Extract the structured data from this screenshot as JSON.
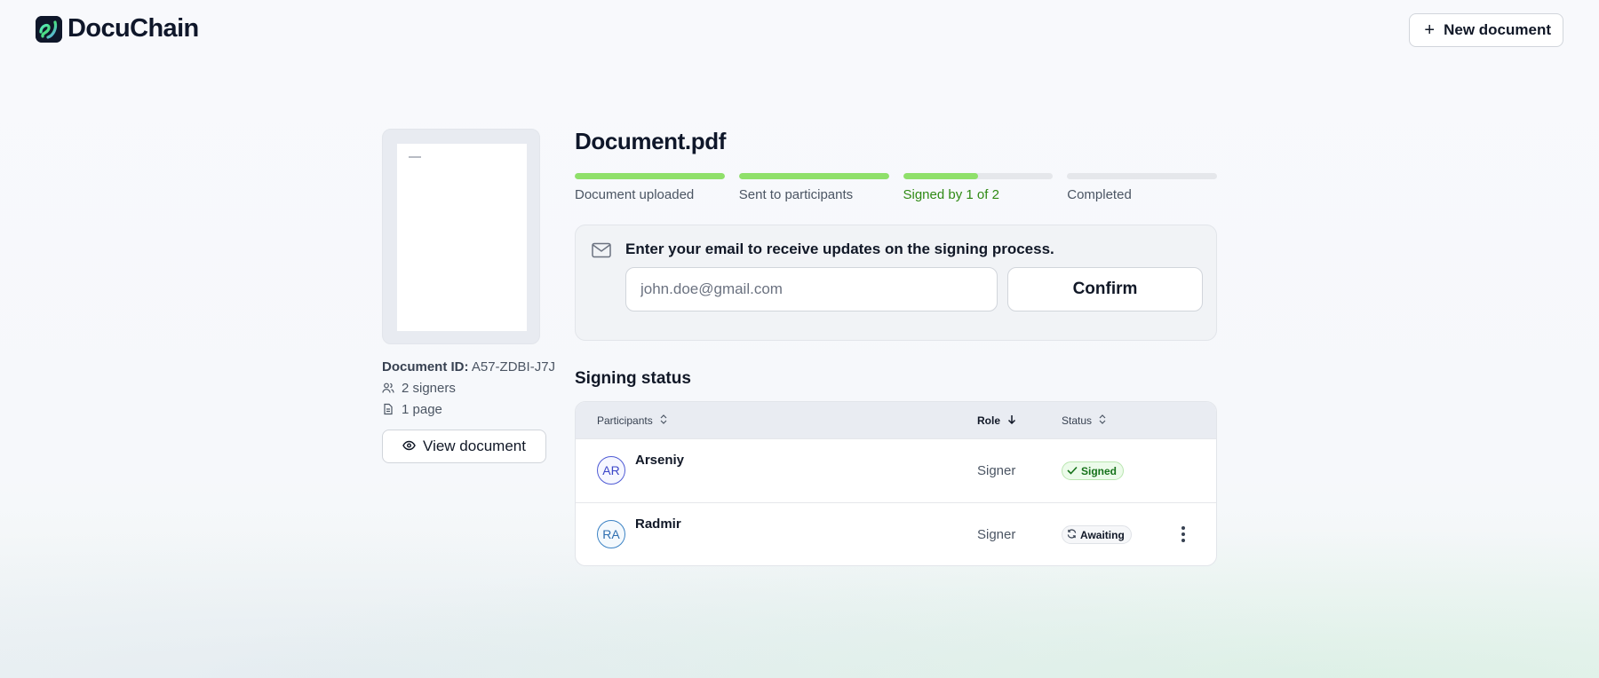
{
  "header": {
    "logo_text": "DocuChain",
    "new_document_label": "New document"
  },
  "sidebar": {
    "document_id_label": "Document ID:",
    "document_id_value": "A57-ZDBI-J7J",
    "signers": "2 signers",
    "pages": "1 page",
    "view_document_label": "View document"
  },
  "main": {
    "title": "Document.pdf",
    "steps": [
      {
        "label": "Document uploaded",
        "progress": 1.0
      },
      {
        "label": "Sent to participants",
        "progress": 1.0
      },
      {
        "label": "Signed by  1 of 2",
        "progress": 0.5
      },
      {
        "label": "Completed",
        "progress": 0.0
      }
    ],
    "email": {
      "prompt": "Enter your email to receive updates on the signing process.",
      "placeholder": "john.doe@gmail.com",
      "value": "",
      "confirm_label": "Confirm"
    },
    "signing_status": {
      "title": "Signing status",
      "columns": [
        "Participants",
        "Role",
        "Status"
      ],
      "rows": [
        {
          "initials": "AR",
          "name": "Arseniy",
          "role": "Signer",
          "status": "Signed"
        },
        {
          "initials": "RA",
          "name": "Radmir",
          "role": "Signer",
          "status": "Awaiting"
        }
      ]
    }
  },
  "colors": {
    "progress_fill": "#8fe06a",
    "progress_track": "#e5e7eb",
    "active_step_text": "#2f8a14",
    "signed_badge_bg": "#ecfbea",
    "signed_badge_text": "#16721a"
  },
  "icons": {
    "logo": "docuchain-logo-icon",
    "new_document": "plus-icon",
    "signers": "users-icon",
    "pages": "file-icon",
    "view": "eye-icon",
    "email": "mail-icon",
    "sort": "sort-icon",
    "sort_down": "arrow-down-icon",
    "signed": "check-icon",
    "awaiting": "refresh-icon",
    "row_menu": "more-vertical-icon"
  }
}
